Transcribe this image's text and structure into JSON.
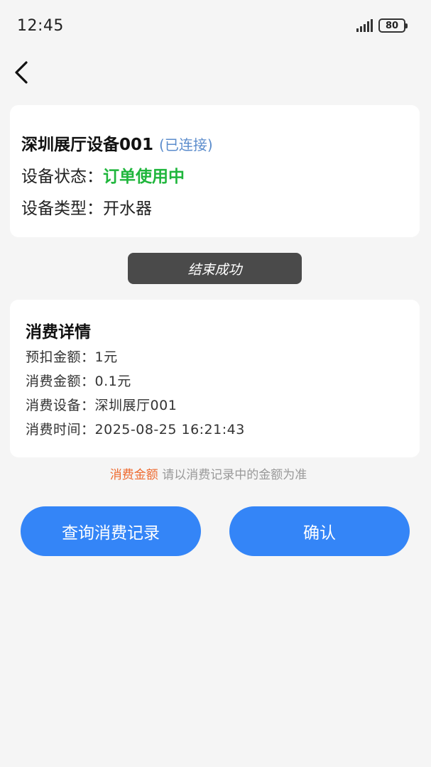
{
  "status_bar": {
    "time": "12:45",
    "battery": "80",
    "icons": [
      "signal-icon",
      "battery-icon"
    ]
  },
  "nav": {
    "back_icon": "chevron-left-icon"
  },
  "device": {
    "name": "深圳展厅设备001",
    "connection": "(已连接)",
    "status_label": "设备状态：",
    "status_value": "订单使用中",
    "status_color": "#1fb63c",
    "type_label": "设备类型：",
    "type_value": "开水器"
  },
  "toast": {
    "message": "结束成功"
  },
  "consumption": {
    "title": "消费详情",
    "rows": [
      {
        "label": "预扣金额：",
        "value": "1元"
      },
      {
        "label": "消费金额：",
        "value": "0.1元"
      },
      {
        "label": "消费设备：",
        "value": "深圳展厅001"
      },
      {
        "label": "消费时间：",
        "value": "2025-08-25 16:21:43"
      }
    ]
  },
  "notice": {
    "highlight": "消费金额",
    "highlight_color": "#ee6a2f",
    "text": " 请以消费记录中的金额为准"
  },
  "actions": {
    "records_label": "查询消费记录",
    "confirm_label": "确认",
    "accent": "#3485f7"
  }
}
